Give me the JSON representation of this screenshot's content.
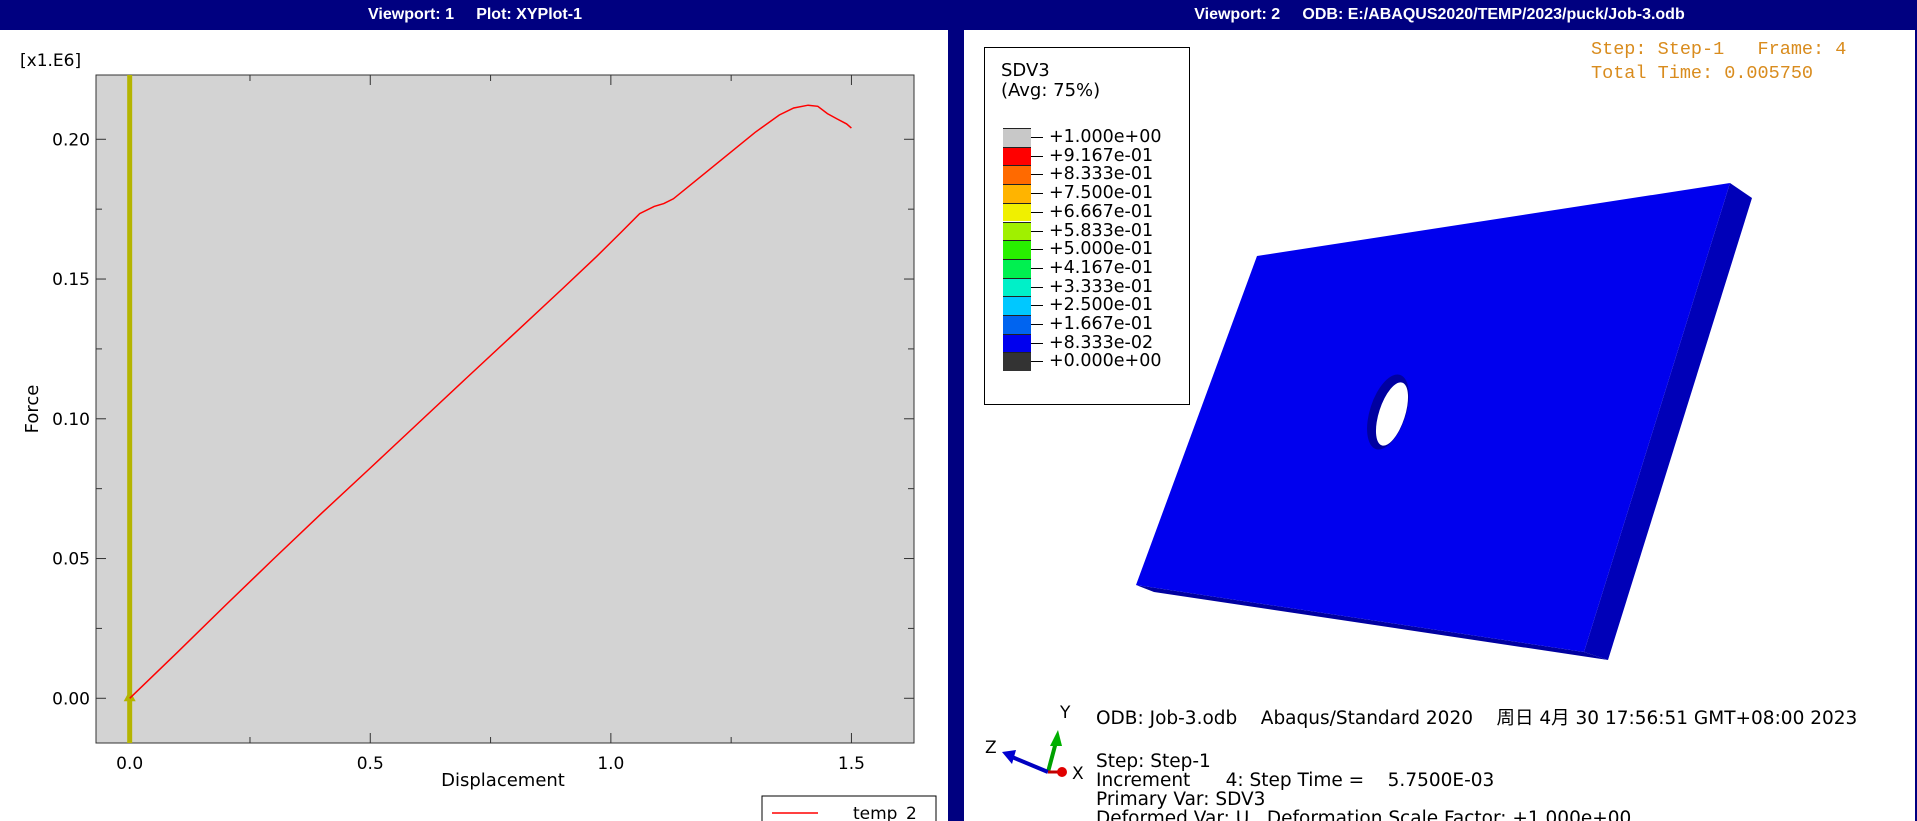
{
  "viewport1": {
    "title": "Viewport: 1     Plot: XYPlot-1",
    "legend": {
      "label": "temp_2"
    }
  },
  "viewport2": {
    "title": "Viewport: 2     ODB: E:/ABAQUS2020/TEMP/2023/puck/Job-3.odb",
    "legend": {
      "title_line1": "SDV3",
      "title_line2": "(Avg: 75%)",
      "labels": [
        "+1.000e+00",
        "+9.167e-01",
        "+8.333e-01",
        "+7.500e-01",
        "+6.667e-01",
        "+5.833e-01",
        "+5.000e-01",
        "+4.167e-01",
        "+3.333e-01",
        "+2.500e-01",
        "+1.667e-01",
        "+8.333e-02",
        "+0.000e+00"
      ],
      "colors": [
        "#c8c8c8",
        "#ff0000",
        "#ff6a00",
        "#ffb400",
        "#f0f000",
        "#a0f000",
        "#28f000",
        "#00f050",
        "#00f0c8",
        "#00c8ff",
        "#0064f0",
        "#0000ee",
        "#333333"
      ]
    },
    "step_info": {
      "line1": "Step: Step-1   Frame: 4",
      "line2": "Total Time: 0.005750"
    },
    "plate_color": "#0000ee",
    "triad": {
      "y": "Y",
      "z": "Z",
      "x": "X"
    },
    "info": {
      "odb_line": "ODB: Job-3.odb    Abaqus/Standard 2020    周日 4月 30 17:56:51 GMT+08:00 2023",
      "step_line": "Step: Step-1",
      "increment_line": "Increment      4: Step Time =    5.7500E-03",
      "primary_var_line": "Primary Var: SDV3",
      "deformed_var_line": "Deformed Var: U   Deformation Scale Factor: +1.000e+00"
    }
  },
  "chart_data": {
    "type": "line",
    "title": "",
    "xlabel": "Displacement",
    "ylabel": "Force",
    "y_multiplier_label": "[x1.E6]",
    "xlim": [
      -0.07,
      1.63
    ],
    "ylim": [
      -0.016,
      0.223
    ],
    "xticks": [
      0.0,
      0.5,
      1.0,
      1.5
    ],
    "xtick_labels": [
      "0.0",
      "0.5",
      "1.0",
      "1.5"
    ],
    "yticks": [
      0.0,
      0.05,
      0.1,
      0.15,
      0.2
    ],
    "ytick_labels": [
      "0.00",
      "0.05",
      "0.10",
      "0.15",
      "0.20"
    ],
    "grid": false,
    "legend_position": "bottom-right",
    "series": [
      {
        "name": "temp_2",
        "color": "#ff0000",
        "x": [
          0.0,
          0.1,
          0.2,
          0.3,
          0.4,
          0.5,
          0.6,
          0.7,
          0.8,
          0.9,
          0.97,
          1.02,
          1.06,
          1.09,
          1.11,
          1.13,
          1.2,
          1.3,
          1.35,
          1.38,
          1.41,
          1.43,
          1.45,
          1.47,
          1.49,
          1.5
        ],
        "y": [
          0.0,
          0.0166,
          0.0334,
          0.05,
          0.0664,
          0.0824,
          0.0985,
          0.1146,
          0.1306,
          0.1466,
          0.158,
          0.1665,
          0.1734,
          0.176,
          0.177,
          0.1787,
          0.1885,
          0.2025,
          0.2087,
          0.2112,
          0.2122,
          0.2118,
          0.2092,
          0.2073,
          0.2055,
          0.204
        ]
      },
      {
        "name": "",
        "color": "#b4b400",
        "x": [
          0.0,
          0.0
        ],
        "y": [
          -0.016,
          0.223
        ]
      }
    ]
  }
}
